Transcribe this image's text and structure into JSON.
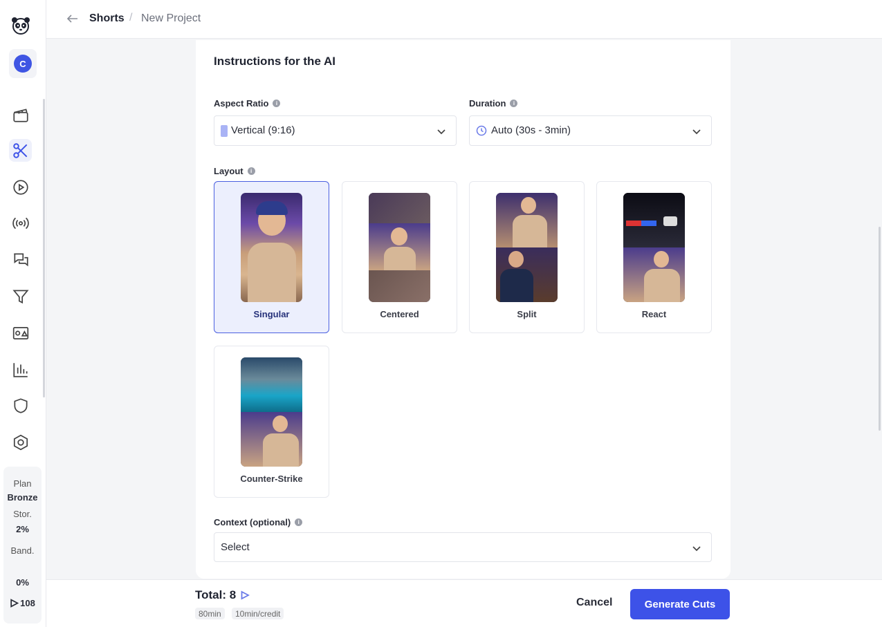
{
  "header": {
    "breadcrumb_root": "Shorts",
    "separator": "/",
    "breadcrumb_current": "New Project"
  },
  "sidebar": {
    "avatar_initial": "C",
    "plan_label": "Plan",
    "plan_value": "Bronze",
    "storage_label": "Stor.",
    "storage_value": "2%",
    "bandwidth_label": "Band.",
    "bandwidth_value": "0%",
    "credits": "108"
  },
  "form": {
    "title": "Instructions for the AI",
    "aspect_ratio": {
      "label": "Aspect Ratio",
      "value": "Vertical (9:16)"
    },
    "duration": {
      "label": "Duration",
      "value": "Auto (30s - 3min)"
    },
    "layout": {
      "label": "Layout",
      "options": [
        {
          "label": "Singular",
          "selected": true
        },
        {
          "label": "Centered",
          "selected": false
        },
        {
          "label": "Split",
          "selected": false
        },
        {
          "label": "React",
          "selected": false
        },
        {
          "label": "Counter-Strike",
          "selected": false
        }
      ]
    },
    "context": {
      "label": "Context (optional)",
      "value": "Select"
    }
  },
  "footer": {
    "total": "Total: 8",
    "duration_chip": "80min",
    "rate_chip": "10min/credit",
    "cancel_label": "Cancel",
    "generate_label": "Generate Cuts"
  },
  "colors": {
    "accent": "#3d52e8",
    "selected_bg": "#eceffd"
  }
}
